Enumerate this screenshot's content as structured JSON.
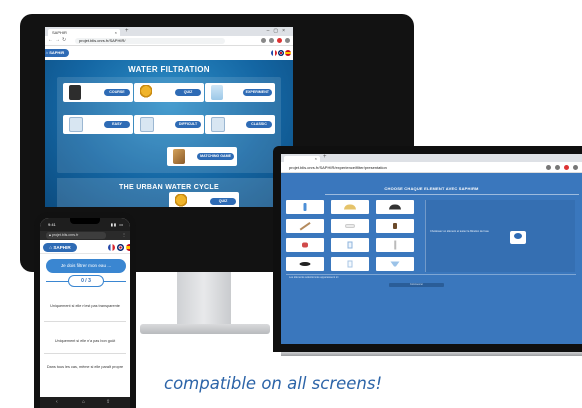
{
  "desktop": {
    "tab_title": "SAPHIR",
    "url": "projet.blis.cnrs.fr/SAPHIR/",
    "app_name": "SAPHIR",
    "section_title": "WATER FILTRATION",
    "tiles": [
      {
        "label": "COURSE",
        "icon": "course-book-icon"
      },
      {
        "label": "QUIZ",
        "icon": "medal-icon"
      },
      {
        "label": "EXPERIMENT",
        "icon": "lab-flask-icon"
      },
      {
        "label": "EASY",
        "icon": "cards-icon"
      },
      {
        "label": "DIFFICULT",
        "icon": "cards-icon"
      },
      {
        "label": "CLASSIC",
        "icon": "cards-icon"
      },
      {
        "label": "MATCHING GAME",
        "icon": "water-pipes-icon"
      }
    ],
    "second_section_title": "THE URBAN WATER CYCLE",
    "second_section_tile": {
      "label": "QUIZ",
      "icon": "medal-icon"
    }
  },
  "laptop": {
    "url": "projet.blis.cnrs.fr/SAPHIR/experience/filter/presentation",
    "heading": "CHOOSE CHAQUE ELEMENT AVEC SAPHIRM",
    "prompt": "Choisissez un élément et testez la filtration de l'eau",
    "note": "Les éléments sélectionnés apparaissent ici",
    "button": "Commencer"
  },
  "phone": {
    "time": "9:41",
    "url": "projet.blis.cnrs.fr",
    "tab_count": "2",
    "app_name": "SAPHIR",
    "question": "Je dois filtrer mon eau ...",
    "counter": "0 / 3",
    "answers": [
      "Uniquement si elle n'est pas transparente",
      "Uniquement si elle n'a pas bon goût",
      "Dans tous les cas, même si elle paraît propre"
    ]
  },
  "tagline": "compatible on all screens!",
  "colors": {
    "brand_blue": "#2e6bb5",
    "hero_blue": "#1466a3",
    "tagline_blue": "#2c64a8"
  }
}
